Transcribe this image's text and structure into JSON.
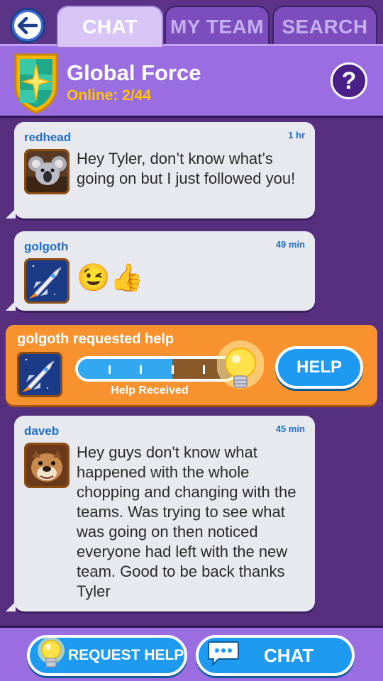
{
  "tabs": {
    "back_label": "back",
    "chat": "CHAT",
    "my_team": "MY TEAM",
    "search": "SEARCH"
  },
  "team": {
    "name": "Global Force",
    "online": "Online: 2/44",
    "help_icon": "?"
  },
  "messages": [
    {
      "name": "redhead",
      "time": "1 hr",
      "avatar": "koala-avatar",
      "text": "Hey Tyler, don’t know what’s going on but I just followed you!"
    },
    {
      "name": "golgoth",
      "time": "49 min",
      "avatar": "spaceship-avatar",
      "text": "😉👍"
    },
    {
      "name": "daveb",
      "time": "45 min",
      "avatar": "bulldog-avatar",
      "text": "Hey guys don't know what happened with the whole chopping and changing with the teams. Was trying to see what was going on then noticed everyone had left with the new team. Good to be back thanks Tyler"
    }
  ],
  "help_request": {
    "title": "golgoth requested help",
    "status": "Help Received",
    "progress_fraction": 0.6,
    "segments": 5,
    "button": "HELP"
  },
  "bottom": {
    "request_help": "REQUEST HELP",
    "chat": "CHAT"
  },
  "colors": {
    "background": "#56307f",
    "header": "#9a6de0",
    "accent_blue": "#1e9bf0",
    "name_blue": "#1f6fc8",
    "online_yellow": "#ffc10f",
    "help_orange": "#f7922e"
  }
}
